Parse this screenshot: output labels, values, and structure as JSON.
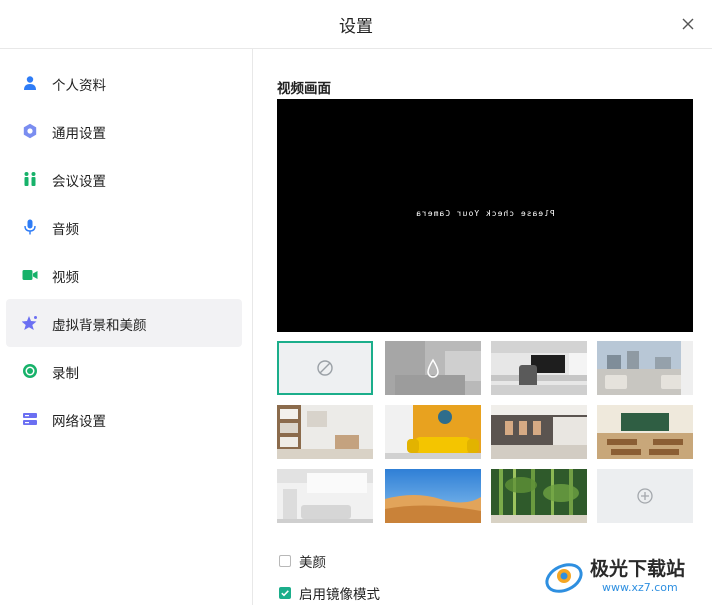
{
  "window": {
    "title": "设置"
  },
  "sidebar": {
    "items": [
      {
        "label": "个人资料",
        "icon": "user-icon"
      },
      {
        "label": "通用设置",
        "icon": "gear-icon"
      },
      {
        "label": "会议设置",
        "icon": "people-icon"
      },
      {
        "label": "音频",
        "icon": "microphone-icon"
      },
      {
        "label": "视频",
        "icon": "camera-icon"
      },
      {
        "label": "虚拟背景和美颜",
        "icon": "sparkle-icon",
        "selected": true
      },
      {
        "label": "录制",
        "icon": "record-icon"
      },
      {
        "label": "网络设置",
        "icon": "server-icon"
      }
    ]
  },
  "content": {
    "section_title": "视频画面",
    "video_message": "Please check Your Camera",
    "backgrounds": [
      {
        "name": "none",
        "selected": true
      },
      {
        "name": "blur"
      },
      {
        "name": "office-desk"
      },
      {
        "name": "lobby-window"
      },
      {
        "name": "study-shelf"
      },
      {
        "name": "yellow-sofa"
      },
      {
        "name": "conference-room"
      },
      {
        "name": "classroom"
      },
      {
        "name": "bright-room"
      },
      {
        "name": "desert"
      },
      {
        "name": "bamboo"
      },
      {
        "name": "add-custom"
      }
    ],
    "beauty_label": "美颜",
    "beauty_checked": false,
    "mirror_label": "启用镜像模式",
    "mirror_checked": true
  },
  "watermark": {
    "text": "极光下载站",
    "url": "www.xz7.com"
  },
  "colors": {
    "accent": "#1bae8b",
    "icon_blue": "#2e7cf6",
    "icon_green": "#17b26a"
  }
}
